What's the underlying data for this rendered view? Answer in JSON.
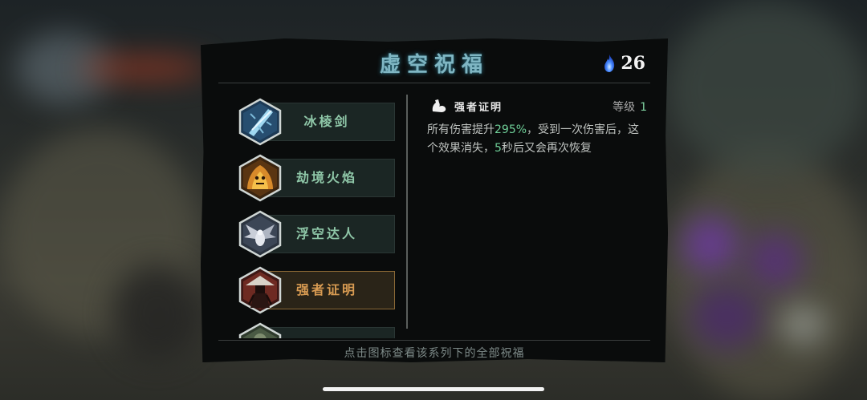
{
  "dialog": {
    "title": "虚空祝福",
    "currency": {
      "icon": "blue-flame-icon",
      "value": "26"
    },
    "hint": "点击图标查看该系列下的全部祝福"
  },
  "blessings": [
    {
      "label": "冰棱剑",
      "icon": "ice-sword-icon",
      "selected": false
    },
    {
      "label": "劫境火焰",
      "icon": "flame-beast-icon",
      "selected": false
    },
    {
      "label": "浮空达人",
      "icon": "winged-creature-icon",
      "selected": false
    },
    {
      "label": "强者证明",
      "icon": "warrior-portrait-icon",
      "selected": true
    },
    {
      "label": "",
      "icon": "partial-blessing-icon",
      "selected": false
    }
  ],
  "detail": {
    "icon": "flexed-arm-icon",
    "name": "强者证明",
    "level_label": "等级",
    "level_value": "1",
    "desc_part1": "所有伤害提升",
    "desc_highlight1": "295%",
    "desc_part2": "，受到一次伤害后，这个效果消失，",
    "desc_highlight2": "5",
    "desc_part3": "秒后又会再次恢复"
  },
  "colors": {
    "title": "#7fb6c3",
    "item_text": "#8fc7a8",
    "selected_text": "#d89b52",
    "highlight": "#6fcf98",
    "currency_flame": "#3b7bff"
  }
}
